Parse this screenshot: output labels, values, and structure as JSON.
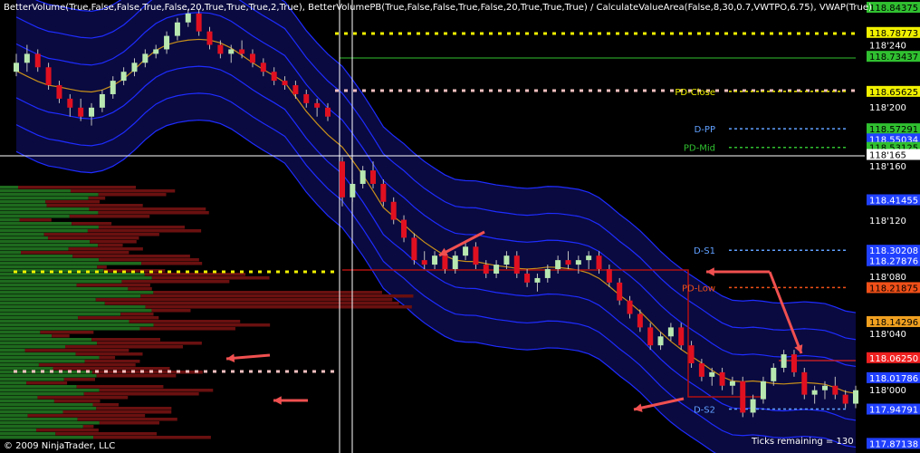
{
  "header": {
    "indicators": "BetterVolume(True,False,False,True,False,20,True,True,True,2,True),  BetterVolumePB(True,False,False,True,False,20,True,True,True)  /  CalculateValueArea(False,8,30,0.7,VWTPO,6.75),  VWAP(True)"
  },
  "footer": {
    "copyright": "© 2009 NinjaTrader, LLC",
    "ticks_remaining": "Ticks remaining = 130"
  },
  "colors": {
    "background": "#000000",
    "band_fill": "#0a0a40",
    "band_line": "#1e2cff",
    "vwap_line": "#c8901a",
    "bull": "#b8e8b0",
    "bear": "#e01020",
    "neutral": "#1a1ae0",
    "value_area_box": "#b01010",
    "up_volume": "#1e6a1e",
    "down_volume": "#6a1010",
    "arrow": "#f05050",
    "dotted_yellow": "#f0f000",
    "dotted_pink": "#f5c0c0"
  },
  "chart_data": {
    "type": "candlestick",
    "y_unit": "price",
    "ylim": [
      117.85,
      118.86
    ],
    "axis_ticks": [
      "118'200",
      "118'160",
      "118'120",
      "118'080",
      "118'040",
      "118'000"
    ],
    "price_badges": [
      {
        "label": "118.84375",
        "value": 118.84375,
        "color": "#30c030",
        "text": "#000000"
      },
      {
        "label": "118.78773",
        "value": 118.7877,
        "color": "#f0f000",
        "text": "#000000"
      },
      {
        "label": "118'240",
        "value": 118.76,
        "color": "#000000",
        "text": "#ffffff"
      },
      {
        "label": "118.73437",
        "value": 118.7344,
        "color": "#30c030",
        "text": "#000000"
      },
      {
        "label": "118.65625",
        "value": 118.6563,
        "color": "#f0f000",
        "text": "#000000"
      },
      {
        "label": "118.57291",
        "value": 118.5729,
        "color": "#30c030",
        "text": "#000000"
      },
      {
        "label": "118.55034",
        "value": 118.5503,
        "color": "#2040ff",
        "text": "#ffffff"
      },
      {
        "label": "118.53125",
        "value": 118.5313,
        "color": "#30c030",
        "text": "#000000"
      },
      {
        "label": "118'165",
        "value": 118.5156,
        "color": "#ffffff",
        "text": "#000000"
      },
      {
        "label": "118.41455",
        "value": 118.4146,
        "color": "#2040ff",
        "text": "#ffffff"
      },
      {
        "label": "118.30208",
        "value": 118.3021,
        "color": "#2040ff",
        "text": "#ffffff"
      },
      {
        "label": "118.27876",
        "value": 118.2788,
        "color": "#2040ff",
        "text": "#ffffff"
      },
      {
        "label": "118.21875",
        "value": 118.2188,
        "color": "#f05018",
        "text": "#000000"
      },
      {
        "label": "118.14296",
        "value": 118.143,
        "color": "#f0a020",
        "text": "#000000"
      },
      {
        "label": "118.06250",
        "value": 118.0625,
        "color": "#f02020",
        "text": "#ffffff"
      },
      {
        "label": "118.01786",
        "value": 118.0179,
        "color": "#2040ff",
        "text": "#ffffff"
      },
      {
        "label": "117.94791",
        "value": 117.9479,
        "color": "#2040ff",
        "text": "#ffffff"
      },
      {
        "label": "117.87138",
        "value": 117.8714,
        "color": "#2040ff",
        "text": "#ffffff"
      }
    ],
    "level_labels": [
      {
        "label": "PD-Close",
        "value": 118.6563,
        "color": "#f0f000"
      },
      {
        "label": "D-PP",
        "value": 118.5729,
        "color": "#60a0ff"
      },
      {
        "label": "PD-Mid",
        "value": 118.5313,
        "color": "#30c030"
      },
      {
        "label": "D-S1",
        "value": 118.3021,
        "color": "#60a0ff"
      },
      {
        "label": "PD-Low",
        "value": 118.2188,
        "color": "#f05018"
      },
      {
        "label": "D-S2",
        "value": 117.9479,
        "color": "#60a0ff"
      }
    ],
    "candles": [
      [
        118.7,
        118.74,
        118.69,
        118.72
      ],
      [
        118.72,
        118.76,
        118.7,
        118.74
      ],
      [
        118.74,
        118.75,
        118.7,
        118.71
      ],
      [
        118.71,
        118.72,
        118.66,
        118.67
      ],
      [
        118.67,
        118.68,
        118.63,
        118.64
      ],
      [
        118.64,
        118.65,
        118.6,
        118.62
      ],
      [
        118.62,
        118.64,
        118.59,
        118.6
      ],
      [
        118.6,
        118.63,
        118.58,
        118.62
      ],
      [
        118.62,
        118.66,
        118.61,
        118.65
      ],
      [
        118.65,
        118.69,
        118.64,
        118.68
      ],
      [
        118.68,
        118.71,
        118.67,
        118.7
      ],
      [
        118.7,
        118.73,
        118.69,
        118.72
      ],
      [
        118.72,
        118.75,
        118.71,
        118.74
      ],
      [
        118.74,
        118.76,
        118.73,
        118.75
      ],
      [
        118.75,
        118.79,
        118.74,
        118.78
      ],
      [
        118.78,
        118.82,
        118.77,
        118.81
      ],
      [
        118.81,
        118.84,
        118.8,
        118.83
      ],
      [
        118.83,
        118.84,
        118.78,
        118.79
      ],
      [
        118.79,
        118.8,
        118.75,
        118.76
      ],
      [
        118.76,
        118.77,
        118.73,
        118.74
      ],
      [
        118.74,
        118.76,
        118.72,
        118.75
      ],
      [
        118.75,
        118.77,
        118.73,
        118.74
      ],
      [
        118.74,
        118.75,
        118.71,
        118.72
      ],
      [
        118.72,
        118.73,
        118.69,
        118.7
      ],
      [
        118.7,
        118.71,
        118.67,
        118.68
      ],
      [
        118.68,
        118.69,
        118.66,
        118.67
      ],
      [
        118.67,
        118.68,
        118.64,
        118.65
      ],
      [
        118.65,
        118.66,
        118.62,
        118.63
      ],
      [
        118.63,
        118.64,
        118.6,
        118.62
      ],
      [
        118.62,
        118.63,
        118.59,
        118.6
      ],
      [
        118.5,
        118.51,
        118.4,
        118.42
      ],
      [
        118.42,
        118.46,
        118.41,
        118.45
      ],
      [
        118.45,
        118.49,
        118.44,
        118.48
      ],
      [
        118.48,
        118.5,
        118.44,
        118.45
      ],
      [
        118.45,
        118.46,
        118.4,
        118.41
      ],
      [
        118.41,
        118.42,
        118.36,
        118.37
      ],
      [
        118.37,
        118.38,
        118.32,
        118.33
      ],
      [
        118.33,
        118.34,
        118.27,
        118.28
      ],
      [
        118.28,
        118.3,
        118.26,
        118.27
      ],
      [
        118.27,
        118.3,
        118.26,
        118.29
      ],
      [
        118.29,
        118.3,
        118.25,
        118.26
      ],
      [
        118.26,
        118.3,
        118.25,
        118.29
      ],
      [
        118.29,
        118.32,
        118.28,
        118.31
      ],
      [
        118.31,
        118.32,
        118.26,
        118.27
      ],
      [
        118.27,
        118.28,
        118.24,
        118.25
      ],
      [
        118.25,
        118.28,
        118.24,
        118.27
      ],
      [
        118.27,
        118.3,
        118.26,
        118.29
      ],
      [
        118.29,
        118.3,
        118.24,
        118.25
      ],
      [
        118.25,
        118.26,
        118.22,
        118.23
      ],
      [
        118.23,
        118.25,
        118.21,
        118.24
      ],
      [
        118.24,
        118.27,
        118.23,
        118.26
      ],
      [
        118.26,
        118.29,
        118.25,
        118.28
      ],
      [
        118.28,
        118.3,
        118.26,
        118.27
      ],
      [
        118.27,
        118.29,
        118.25,
        118.28
      ],
      [
        118.28,
        118.3,
        118.26,
        118.29
      ],
      [
        118.29,
        118.3,
        118.25,
        118.26
      ],
      [
        118.26,
        118.27,
        118.22,
        118.23
      ],
      [
        118.23,
        118.24,
        118.18,
        118.19
      ],
      [
        118.19,
        118.2,
        118.15,
        118.16
      ],
      [
        118.16,
        118.17,
        118.12,
        118.13
      ],
      [
        118.13,
        118.14,
        118.08,
        118.09
      ],
      [
        118.09,
        118.12,
        118.08,
        118.11
      ],
      [
        118.11,
        118.14,
        118.1,
        118.13
      ],
      [
        118.13,
        118.14,
        118.08,
        118.09
      ],
      [
        118.09,
        118.1,
        118.04,
        118.05
      ],
      [
        118.05,
        118.06,
        118.01,
        118.02
      ],
      [
        118.02,
        118.04,
        118.0,
        118.03
      ],
      [
        118.03,
        118.04,
        117.99,
        118.0
      ],
      [
        118.0,
        118.02,
        117.98,
        118.01
      ],
      [
        118.01,
        118.02,
        117.93,
        117.94
      ],
      [
        117.94,
        117.98,
        117.93,
        117.97
      ],
      [
        117.97,
        118.02,
        117.96,
        118.01
      ],
      [
        118.01,
        118.05,
        118.0,
        118.04
      ],
      [
        118.04,
        118.08,
        118.03,
        118.07
      ],
      [
        118.07,
        118.08,
        118.02,
        118.03
      ],
      [
        118.03,
        118.04,
        117.97,
        117.98
      ],
      [
        117.98,
        118.0,
        117.96,
        117.99
      ],
      [
        117.99,
        118.01,
        117.97,
        118.0
      ],
      [
        118.0,
        118.02,
        117.97,
        117.98
      ],
      [
        117.98,
        117.99,
        117.95,
        117.96
      ],
      [
        117.96,
        118.0,
        117.95,
        117.99
      ]
    ],
    "band_offsets": [
      0.06,
      0.12,
      0.18
    ]
  }
}
